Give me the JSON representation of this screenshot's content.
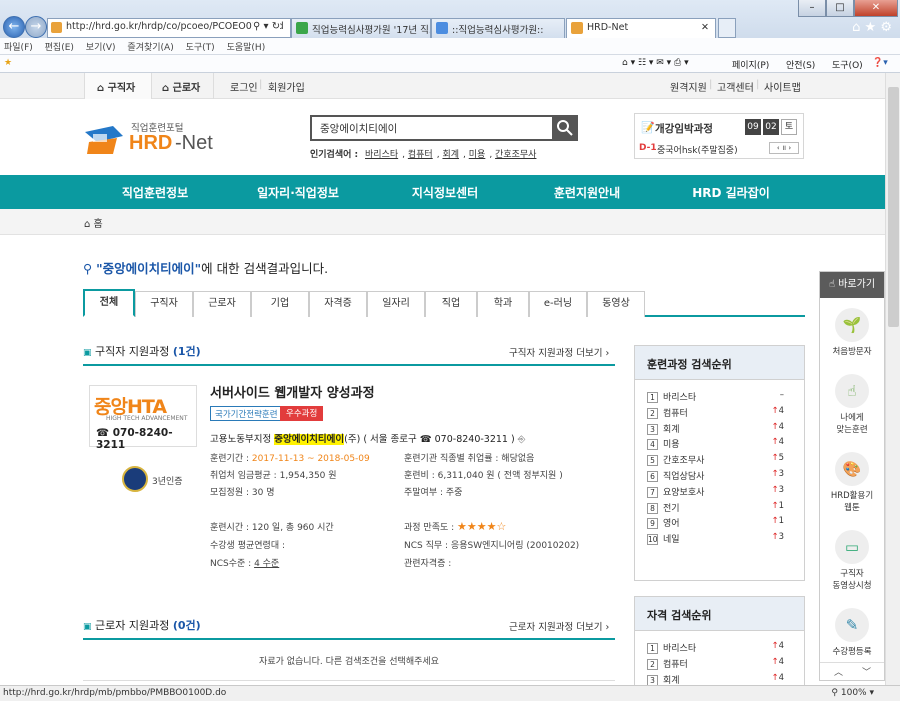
{
  "browser": {
    "url": "http://hrd.go.kr/hrdp/co/pcoeo/PCOEO0100T.d",
    "tabs": [
      {
        "label": "직업능력심사평가원 '17년 직..."
      },
      {
        "label": "::직업능력심사평가원::"
      },
      {
        "label": "HRD-Net"
      }
    ],
    "menu": [
      "파일(F)",
      "편집(E)",
      "보기(V)",
      "즐겨찾기(A)",
      "도구(T)",
      "도움말(H)"
    ],
    "commands": [
      "페이지(P)",
      "안전(S)",
      "도구(O)"
    ],
    "status_url": "http://hrd.go.kr/hrdp/mb/pmbbo/PMBBO0100D.do",
    "zoom": "100%"
  },
  "topnav": {
    "job_seeker": "구직자",
    "worker": "근로자",
    "login": "로그인",
    "signup": "회원가입",
    "remote": "원격지원",
    "customer": "고객센터",
    "sitemap": "사이트맵"
  },
  "logo": {
    "sub": "직업훈련포털",
    "main_hrd": "HRD",
    "main_net": "-Net"
  },
  "search": {
    "value": "중앙에이치티에이",
    "popular_label": "인기검색어 :",
    "popular": [
      "바리스타",
      "컴퓨터",
      "회계",
      "미용",
      "간호조무사"
    ]
  },
  "schedule": {
    "title": "개강임박과정",
    "month": "09",
    "day": "02",
    "weekday": "토",
    "dday": "D-1",
    "course": "중국어hsk(주말집중)"
  },
  "mainnav": [
    "직업훈련정보",
    "일자리·직업정보",
    "지식정보센터",
    "훈련지원안내",
    "HRD 길라잡이"
  ],
  "crumb": "홈",
  "result": {
    "keyword": "\"중앙에이치티에이\"",
    "suffix": "에 대한 검색결과입니다."
  },
  "tabs": [
    "전체",
    "구직자",
    "근로자",
    "기업",
    "자격증",
    "일자리",
    "직업",
    "학과",
    "e-러닝",
    "동영상"
  ],
  "section1": {
    "title": "구직자 지원과정",
    "count": "(1건)",
    "more": "구직자 지원과정 더보기"
  },
  "course": {
    "title": "서버사이드 웹개발자 양성과정",
    "badge1": "국가기간전략훈련",
    "badge2": "우수과정",
    "org_prefix": "고용노동부지정",
    "org_name": "중앙에이치티에이",
    "org_suffix": "(주)  ( 서울 종로구 ☎ 070-8240-3211 )",
    "logo_name": "중앙HTA",
    "logo_sub": "HIGH TECH ADVANCEMENT",
    "logo_phone": "☎ 070-8240-3211",
    "cert": "3년인증",
    "period_label": "훈련기간 :",
    "period": "2017-11-13 ~ 2018-05-09",
    "employ_label": "훈련기관 직종별 취업률 :",
    "employ": "해당없음",
    "wage_label": "취업처 임금평균 :",
    "wage": "1,954,350 원",
    "fee_label": "훈련비 :",
    "fee": "6,311,040 원 ( 전액 정부지원 )",
    "quota_label": "모집정원 :",
    "quota": "30 명",
    "weekend_label": "주말여부 :",
    "weekend": "주중",
    "hours_label": "훈련시간 :",
    "hours": "120 일, 총 960 시간",
    "satis_label": "과정 만족도 :",
    "rating": 4,
    "rating_max": 5,
    "age_label": "수강생 평균연령대 :",
    "age": "",
    "ncs_label": "NCS 직무 :",
    "ncs": "응용SW엔지니어링 (20010202)",
    "ncslevel_label": "NCS수준 :",
    "ncslevel": "4 수준",
    "cert_label": "관련자격증 :",
    "certs": ""
  },
  "section2": {
    "title": "근로자 지원과정",
    "count": "(0건)",
    "more": "근로자 지원과정 더보기",
    "empty": "자료가 없습니다. 다른 검색조건을 선택해주세요"
  },
  "rank1": {
    "title": "훈련과정 검색순위",
    "items": [
      {
        "n": "1",
        "name": "바리스타",
        "change": "–",
        "up": false
      },
      {
        "n": "2",
        "name": "컴퓨터",
        "change": "4",
        "up": true
      },
      {
        "n": "3",
        "name": "회계",
        "change": "4",
        "up": true
      },
      {
        "n": "4",
        "name": "미용",
        "change": "4",
        "up": true
      },
      {
        "n": "5",
        "name": "간호조무사",
        "change": "5",
        "up": true
      },
      {
        "n": "6",
        "name": "직업상담사",
        "change": "3",
        "up": true
      },
      {
        "n": "7",
        "name": "요양보호사",
        "change": "3",
        "up": true
      },
      {
        "n": "8",
        "name": "전기",
        "change": "1",
        "up": true
      },
      {
        "n": "9",
        "name": "영어",
        "change": "1",
        "up": true
      },
      {
        "n": "10",
        "name": "네일",
        "change": "3",
        "up": true
      }
    ]
  },
  "rank2": {
    "title": "자격 검색순위",
    "items": [
      {
        "n": "1",
        "name": "바리스타",
        "change": "4",
        "up": true
      },
      {
        "n": "2",
        "name": "컴퓨터",
        "change": "4",
        "up": true
      },
      {
        "n": "3",
        "name": "회계",
        "change": "4",
        "up": true
      }
    ]
  },
  "quick": {
    "title": "바로가기",
    "items": [
      "처음방문자",
      "나에게\n맞는훈련",
      "HRD활용기\n웹툰",
      "구직자\n동영상시청",
      "수강평등록"
    ]
  },
  "colors": {
    "teal": "#0b9aa0",
    "blue": "#1a56a8",
    "orange": "#f08519",
    "red": "#e23c3c",
    "highlight": "#fff200"
  }
}
